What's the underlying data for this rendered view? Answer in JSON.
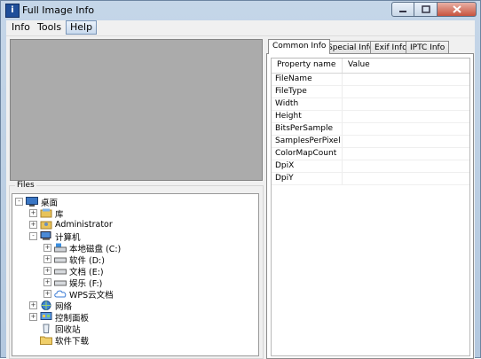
{
  "window": {
    "title": "Full Image Info",
    "icon": "info-app-icon"
  },
  "menu": {
    "items": [
      "Info",
      "Tools",
      "Help"
    ],
    "active": "Help"
  },
  "files": {
    "legend": "Files",
    "tree": [
      {
        "label": "桌面",
        "icon": "desktop-icon",
        "expander": "-"
      },
      {
        "label": "库",
        "icon": "library-icon",
        "expander": "+"
      },
      {
        "label": "Administrator",
        "icon": "user-folder-icon",
        "expander": "+"
      },
      {
        "label": "计算机",
        "icon": "computer-icon",
        "expander": "-"
      },
      {
        "label": "本地磁盘 (C:)",
        "icon": "local-disk-icon",
        "expander": "+"
      },
      {
        "label": "软件 (D:)",
        "icon": "drive-icon",
        "expander": "+"
      },
      {
        "label": "文档 (E:)",
        "icon": "drive-icon",
        "expander": "+"
      },
      {
        "label": "娱乐 (F:)",
        "icon": "drive-icon",
        "expander": "+"
      },
      {
        "label": "WPS云文档",
        "icon": "cloud-icon",
        "expander": "+"
      },
      {
        "label": "网络",
        "icon": "network-icon",
        "expander": "+"
      },
      {
        "label": "控制面板",
        "icon": "control-panel-icon",
        "expander": "+"
      },
      {
        "label": "回收站",
        "icon": "recycle-bin-icon",
        "expander": ""
      },
      {
        "label": "软件下载",
        "icon": "folder-icon",
        "expander": ""
      }
    ]
  },
  "tabs": {
    "items": [
      "Common Info",
      "Special Info",
      "Exif Info",
      "IPTC Info"
    ],
    "active": "Common Info"
  },
  "grid": {
    "headers": [
      "Property name",
      "Value"
    ],
    "rows": [
      "FileName",
      "FileType",
      "Width",
      "Height",
      "BitsPerSample",
      "SamplesPerPixel",
      "ColorMapCount",
      "DpiX",
      "DpiY"
    ]
  },
  "colors": {
    "preview_bg": "#ababab",
    "titlebar": "#c5d6e8",
    "close_button": "#c7533e"
  }
}
